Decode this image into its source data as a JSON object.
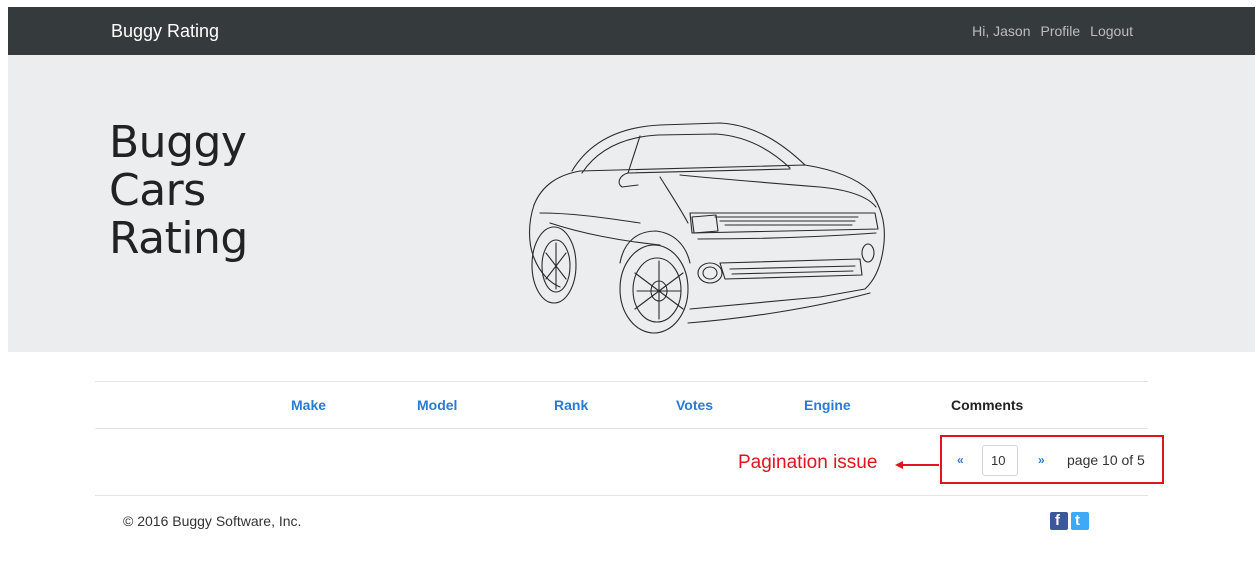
{
  "nav": {
    "brand": "Buggy Rating",
    "greeting": "Hi, Jason",
    "profile": "Profile",
    "logout": "Logout"
  },
  "hero": {
    "title_lines": [
      "Buggy",
      "Cars",
      "Rating"
    ]
  },
  "table": {
    "headers": {
      "make": "Make",
      "model": "Model",
      "rank": "Rank",
      "votes": "Votes",
      "engine": "Engine",
      "comments": "Comments"
    }
  },
  "pagination": {
    "prev": "«",
    "page_value": "10",
    "next": "»",
    "info": "page 10 of 5"
  },
  "annotation": {
    "label": "Pagination issue",
    "color": "#e0141e"
  },
  "footer": {
    "copyright": "© 2016 Buggy Software, Inc.",
    "social": [
      "facebook-icon",
      "twitter-icon"
    ]
  },
  "colors": {
    "navbar": "#353a3d",
    "hero_bg": "#ecedee",
    "link": "#2a7ad8"
  }
}
